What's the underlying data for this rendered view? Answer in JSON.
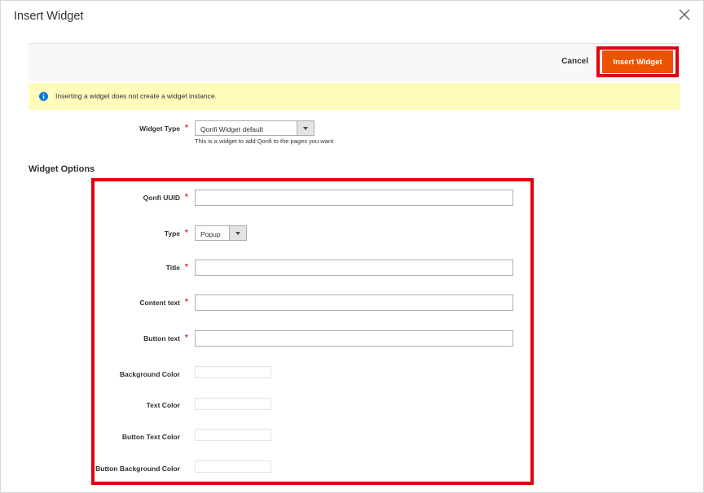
{
  "modal": {
    "title": "Insert Widget"
  },
  "toolbar": {
    "cancel_label": "Cancel",
    "insert_label": "Insert Widget"
  },
  "notice": {
    "text": "Inserting a widget does not create a widget instance."
  },
  "widget_type": {
    "label": "Widget Type",
    "required_mark": "*",
    "selected": "Qonfi Widget default",
    "helper": "This is a widget to add Qonfi to the pages you want"
  },
  "widget_options": {
    "title": "Widget Options",
    "fields": {
      "uuid": {
        "label": "Qonfi UUID",
        "required_mark": "*",
        "value": ""
      },
      "type": {
        "label": "Type",
        "required_mark": "*",
        "selected": "Popup"
      },
      "title": {
        "label": "Title",
        "required_mark": "*",
        "value": ""
      },
      "content_text": {
        "label": "Content text",
        "required_mark": "*",
        "value": ""
      },
      "button_text": {
        "label": "Button text",
        "required_mark": "*",
        "value": ""
      },
      "background_color": {
        "label": "Background Color",
        "value": ""
      },
      "text_color": {
        "label": "Text Color",
        "value": ""
      },
      "button_text_color": {
        "label": "Button Text Color",
        "value": ""
      },
      "button_background_color": {
        "label": "Button Background Color",
        "value": ""
      }
    }
  },
  "colors": {
    "accent": "#eb5202",
    "highlight": "#e0000e",
    "notice_bg": "#fffbbb",
    "info_icon": "#007bdb",
    "required": "#e22626"
  },
  "icons": {
    "close": "close-icon",
    "info": "info-icon",
    "dropdown": "chevron-down-icon"
  }
}
